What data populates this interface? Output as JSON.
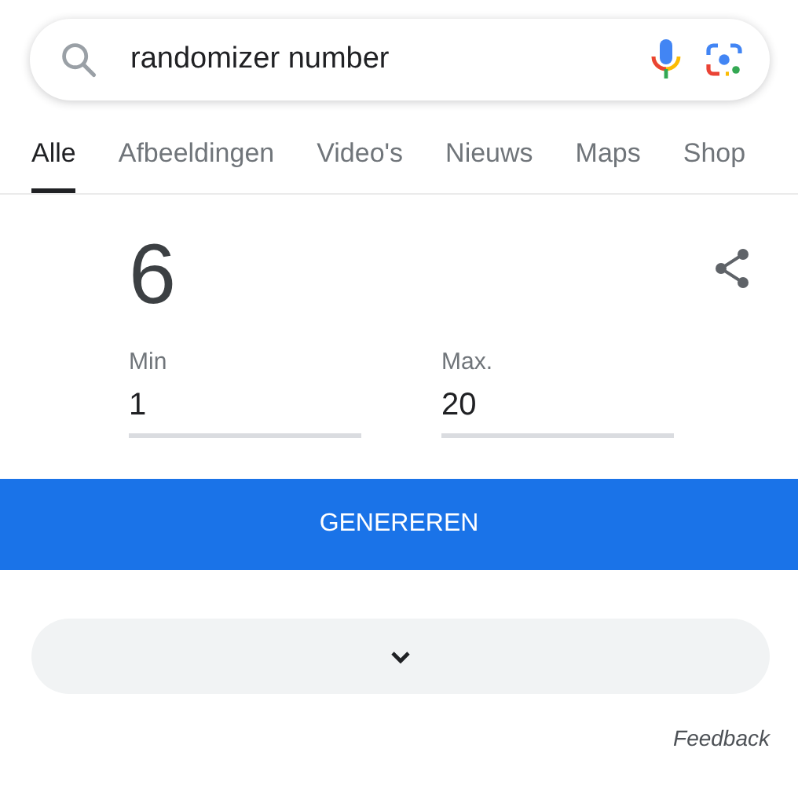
{
  "search": {
    "value": "randomizer number"
  },
  "tabs": [
    {
      "label": "Alle",
      "selected": true
    },
    {
      "label": "Afbeeldingen",
      "selected": false
    },
    {
      "label": "Video's",
      "selected": false
    },
    {
      "label": "Nieuws",
      "selected": false
    },
    {
      "label": "Maps",
      "selected": false
    },
    {
      "label": "Shop",
      "selected": false
    }
  ],
  "result": {
    "number": "6"
  },
  "fields": [
    {
      "label": "Min",
      "value": "1"
    },
    {
      "label": "Max.",
      "value": "20"
    }
  ],
  "generate_button": "GENEREREN",
  "feedback": "Feedback"
}
